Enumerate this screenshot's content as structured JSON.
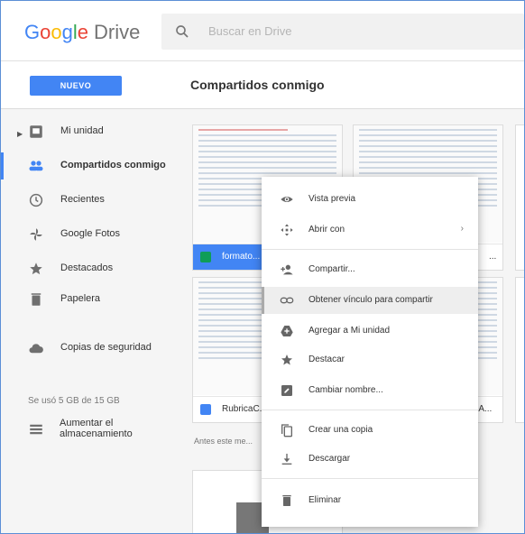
{
  "app": {
    "logo_google": [
      "G",
      "o",
      "o",
      "g",
      "l",
      "e"
    ],
    "logo_drive": "Drive",
    "search_placeholder": "Buscar en Drive"
  },
  "toolbar": {
    "new_label": "NUEVO",
    "page_title": "Compartidos conmigo"
  },
  "sidebar": {
    "items": [
      {
        "label": "Mi unidad",
        "icon": "drive-icon"
      },
      {
        "label": "Compartidos conmigo",
        "icon": "people-icon"
      },
      {
        "label": "Recientes",
        "icon": "clock-icon"
      },
      {
        "label": "Google Fotos",
        "icon": "pinwheel-icon"
      },
      {
        "label": "Destacados",
        "icon": "star-icon"
      },
      {
        "label": "Papelera",
        "icon": "trash-icon"
      },
      {
        "label": "Copias de seguridad",
        "icon": "cloud-icon"
      }
    ],
    "storage_text": "Se usó 5 GB de 15 GB",
    "upgrade_label": "Aumentar el almacenamiento"
  },
  "files": [
    {
      "name": "formato...",
      "type": "sheets"
    },
    {
      "name": "...",
      "type": "sheets"
    },
    {
      "name": "RubricaC...",
      "type": "docs"
    },
    {
      "name": "...A...",
      "type": "docs"
    }
  ],
  "note_text": "Antes este me...",
  "context_menu": {
    "items": [
      {
        "label": "Vista previa",
        "icon": "eye-icon"
      },
      {
        "label": "Abrir con",
        "icon": "open-with-icon",
        "submenu_arrow": "›"
      },
      {
        "label": "Compartir...",
        "icon": "person-add-icon"
      },
      {
        "label": "Obtener vínculo para compartir",
        "icon": "link-icon"
      },
      {
        "label": "Agregar a Mi unidad",
        "icon": "add-drive-icon"
      },
      {
        "label": "Destacar",
        "icon": "star-icon"
      },
      {
        "label": "Cambiar nombre...",
        "icon": "rename-icon"
      },
      {
        "label": "Crear una copia",
        "icon": "copy-icon"
      },
      {
        "label": "Descargar",
        "icon": "download-icon"
      },
      {
        "label": "Eliminar",
        "icon": "trash-icon"
      }
    ]
  },
  "colors": {
    "accent": "#4285f4",
    "sheets": "#0f9d58",
    "docs": "#4285f4"
  }
}
